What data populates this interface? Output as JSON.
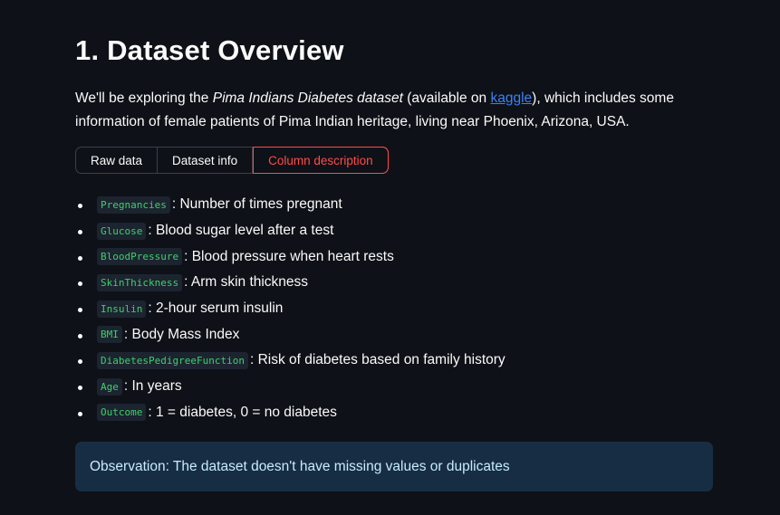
{
  "heading": "1. Dataset Overview",
  "intro": {
    "part1": "We'll be exploring the ",
    "dataset_name": "Pima Indians Diabetes dataset",
    "part2": " (available on ",
    "link_text": "kaggle",
    "part3": "), which includes some information of female patients of Pima Indian heritage, living near Phoenix, Arizona, USA."
  },
  "tabs": [
    {
      "label": "Raw data"
    },
    {
      "label": "Dataset info"
    },
    {
      "label": "Column description",
      "active": true
    }
  ],
  "columns": [
    {
      "name": "Pregnancies",
      "desc": ": Number of times pregnant"
    },
    {
      "name": "Glucose",
      "desc": ": Blood sugar level after a test"
    },
    {
      "name": "BloodPressure",
      "desc": ": Blood pressure when heart rests"
    },
    {
      "name": "SkinThickness",
      "desc": ": Arm skin thickness"
    },
    {
      "name": "Insulin",
      "desc": ": 2-hour serum insulin"
    },
    {
      "name": "BMI",
      "desc": ": Body Mass Index"
    },
    {
      "name": "DiabetesPedigreeFunction",
      "desc": ": Risk of diabetes based on family history"
    },
    {
      "name": "Age",
      "desc": ": In years"
    },
    {
      "name": "Outcome",
      "desc": ": 1 = diabetes, 0 = no diabetes"
    }
  ],
  "observation": "Observation: The dataset doesn't have missing values or duplicates",
  "colors": {
    "background": "#0e1117",
    "accent": "#ff4b4b",
    "link": "#3b82f6",
    "code_text": "#3ecf6b",
    "info_bg": "#172d43",
    "info_text": "#c7ebff"
  }
}
